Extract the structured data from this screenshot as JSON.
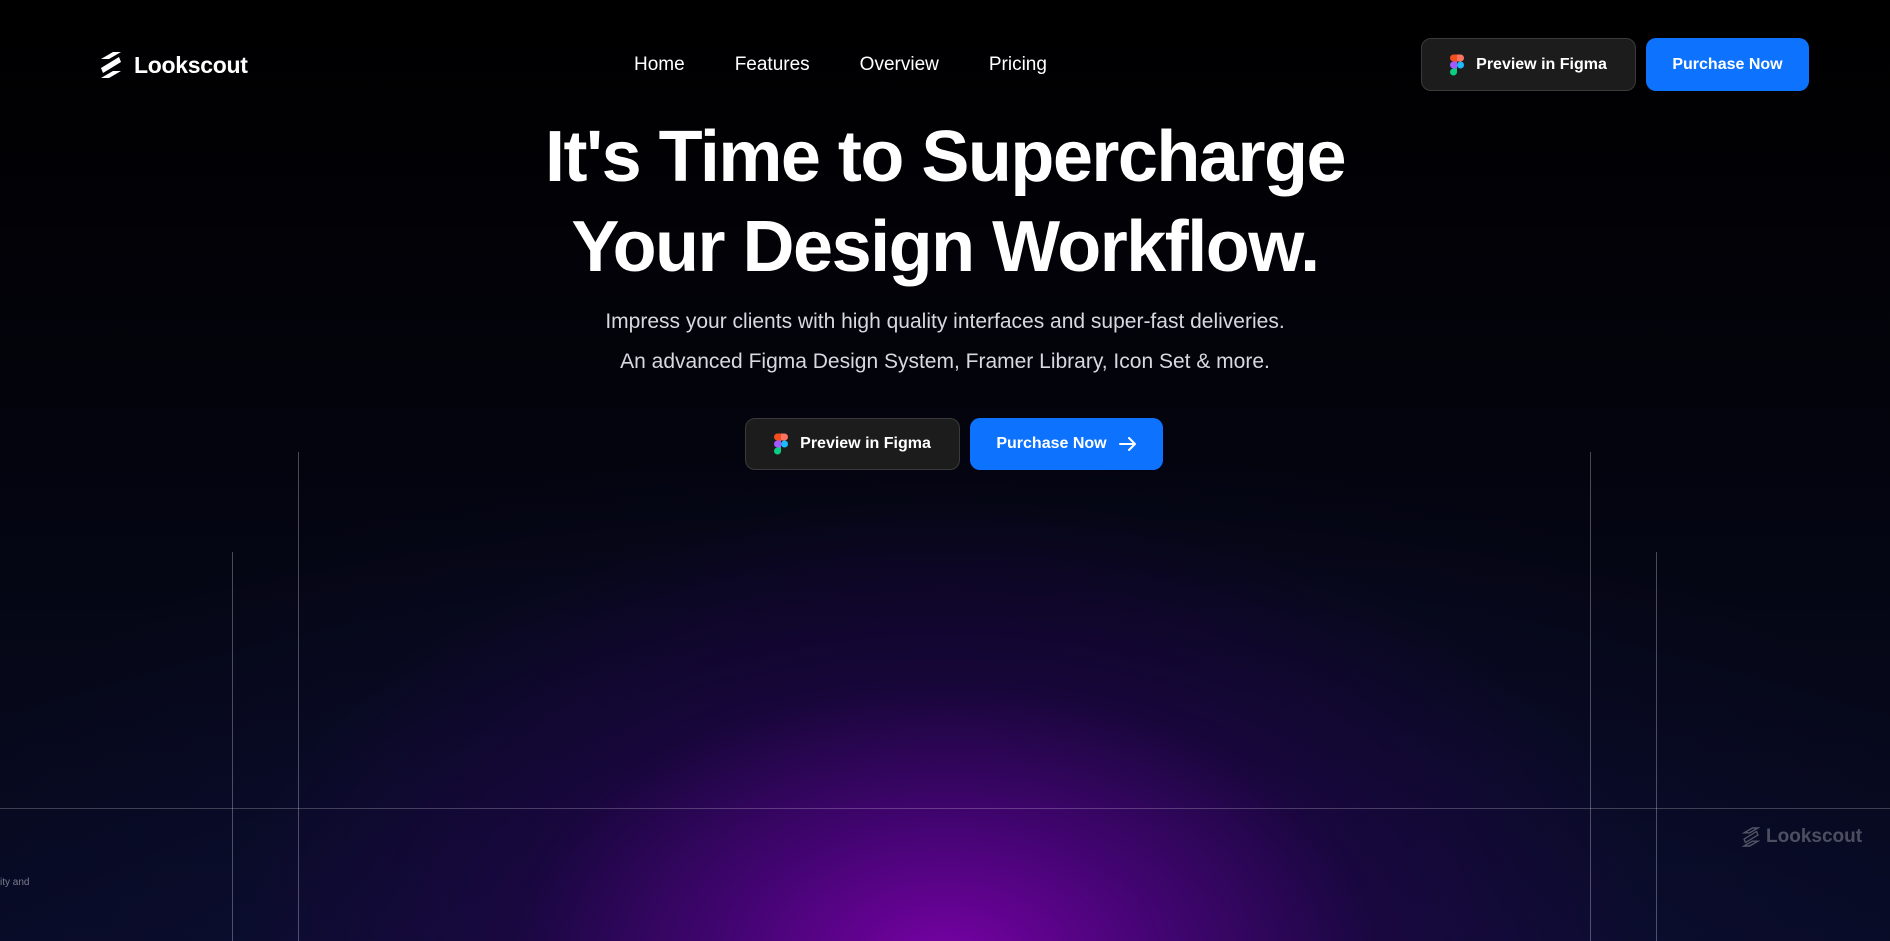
{
  "brand": {
    "name": "Lookscout"
  },
  "nav": {
    "items": [
      "Home",
      "Features",
      "Overview",
      "Pricing"
    ],
    "preview_label": "Preview in Figma",
    "purchase_label": "Purchase Now"
  },
  "hero": {
    "title_line1": "It's Time to Supercharge",
    "title_line2": "Your Design Workflow.",
    "subtitle_line1": "Impress your clients with high quality interfaces and super-fast deliveries.",
    "subtitle_line2": "An advanced Figma Design System, Framer Library, Icon Set & more.",
    "preview_label": "Preview in Figma",
    "purchase_label": "Purchase Now"
  },
  "preview": {
    "watermark": "Lookscout",
    "edge_text": "ity and"
  },
  "icons": {
    "logo": "lookscout-logo-icon",
    "figma": "figma-icon",
    "arrow": "arrow-right-icon"
  },
  "colors": {
    "accent": "#0d73ff",
    "dark_button": "#1c1c1c",
    "glow": "#7d00aa"
  }
}
